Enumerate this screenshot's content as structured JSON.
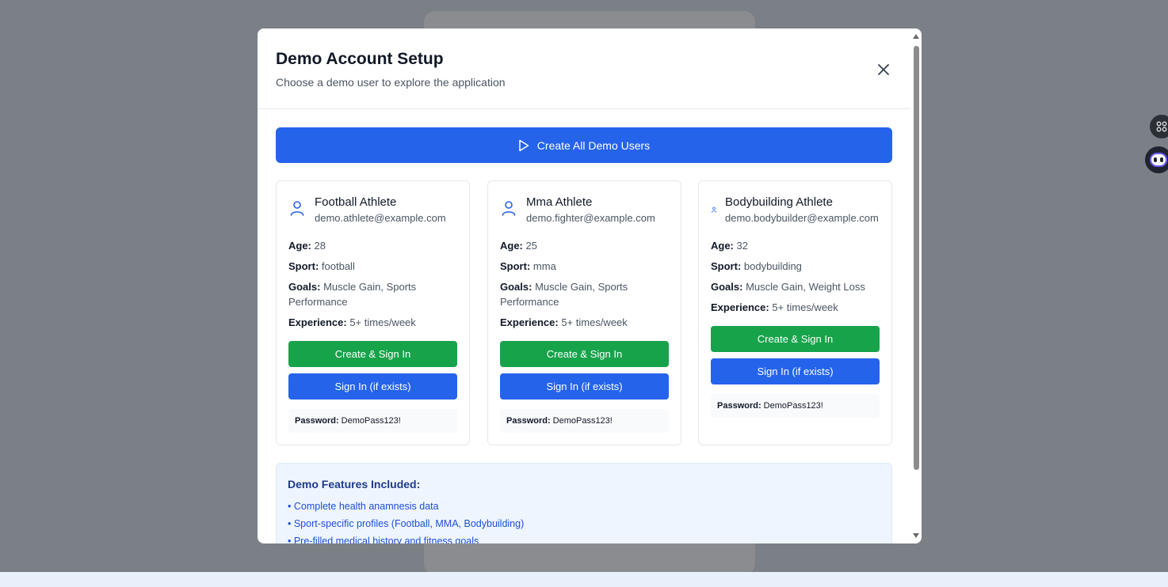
{
  "modal": {
    "title": "Demo Account Setup",
    "subtitle": "Choose a demo user to explore the application",
    "create_all_label": "Create All Demo Users"
  },
  "labels": {
    "age": "Age:",
    "sport": "Sport:",
    "goals": "Goals:",
    "experience": "Experience:",
    "password": "Password:",
    "create_sign_in": "Create & Sign In",
    "sign_in_if_exists": "Sign In (if exists)"
  },
  "users": [
    {
      "name": "Football Athlete",
      "email": "demo.athlete@example.com",
      "age": "28",
      "sport": "football",
      "goals": "Muscle Gain, Sports Performance",
      "experience": "5+ times/week",
      "password": "DemoPass123!"
    },
    {
      "name": "Mma Athlete",
      "email": "demo.fighter@example.com",
      "age": "25",
      "sport": "mma",
      "goals": "Muscle Gain, Sports Performance",
      "experience": "5+ times/week",
      "password": "DemoPass123!"
    },
    {
      "name": "Bodybuilding Athlete",
      "email": "demo.bodybuilder@example.com",
      "age": "32",
      "sport": "bodybuilding",
      "goals": "Muscle Gain, Weight Loss",
      "experience": "5+ times/week",
      "password": "DemoPass123!"
    }
  ],
  "features": {
    "title": "Demo Features Included:",
    "items": [
      "• Complete health anamnesis data",
      "• Sport-specific profiles (Football, MMA, Bodybuilding)",
      "• Pre-filled medical history and fitness goals"
    ]
  },
  "colors": {
    "primary_blue": "#2563eb",
    "success_green": "#16a34a",
    "overlay": "#7b7f86"
  },
  "icons": {
    "close": "close-icon",
    "play": "play-icon",
    "user": "user-icon"
  }
}
